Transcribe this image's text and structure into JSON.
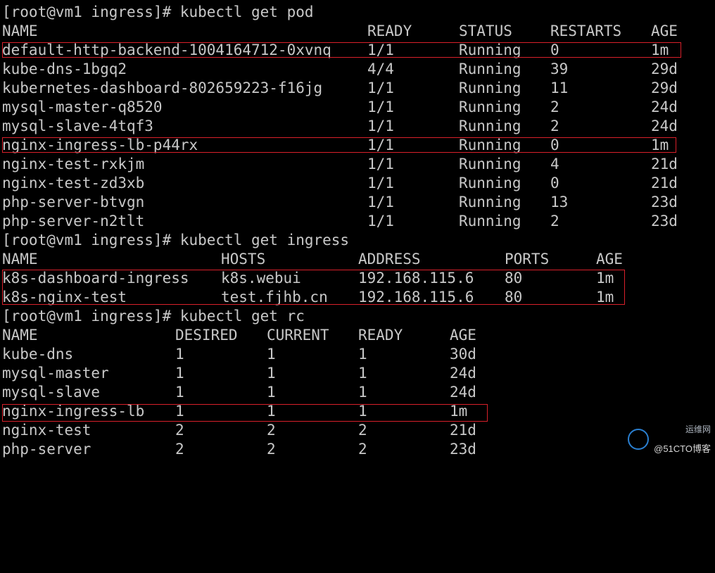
{
  "prompt1": "[root@vm1 ingress]# kubectl get pod",
  "pods": {
    "headers": [
      "NAME",
      "READY",
      "STATUS",
      "RESTARTS",
      "AGE"
    ],
    "rows": [
      [
        "default-http-backend-1004164712-0xvnq",
        "1/1",
        "Running",
        "0",
        "1m"
      ],
      [
        "kube-dns-1bgq2",
        "4/4",
        "Running",
        "39",
        "29d"
      ],
      [
        "kubernetes-dashboard-802659223-f16jg",
        "1/1",
        "Running",
        "11",
        "29d"
      ],
      [
        "mysql-master-q8520",
        "1/1",
        "Running",
        "2",
        "24d"
      ],
      [
        "mysql-slave-4tqf3",
        "1/1",
        "Running",
        "2",
        "24d"
      ],
      [
        "nginx-ingress-lb-p44rx",
        "1/1",
        "Running",
        "0",
        "1m"
      ],
      [
        "nginx-test-rxkjm",
        "1/1",
        "Running",
        "4",
        "21d"
      ],
      [
        "nginx-test-zd3xb",
        "1/1",
        "Running",
        "0",
        "21d"
      ],
      [
        "php-server-btvgn",
        "1/1",
        "Running",
        "13",
        "23d"
      ],
      [
        "php-server-n2tlt",
        "1/1",
        "Running",
        "2",
        "23d"
      ]
    ]
  },
  "prompt2": "[root@vm1 ingress]# kubectl get ingress",
  "ingress": {
    "headers": [
      "NAME",
      "HOSTS",
      "ADDRESS",
      "PORTS",
      "AGE"
    ],
    "rows": [
      [
        "k8s-dashboard-ingress",
        "k8s.webui",
        "192.168.115.6",
        "80",
        "1m"
      ],
      [
        "k8s-nginx-test",
        "test.fjhb.cn",
        "192.168.115.6",
        "80",
        "1m"
      ]
    ]
  },
  "prompt3": "[root@vm1 ingress]# kubectl get rc",
  "rc": {
    "headers": [
      "NAME",
      "DESIRED",
      "CURRENT",
      "READY",
      "AGE"
    ],
    "rows": [
      [
        "kube-dns",
        "1",
        "1",
        "1",
        "30d"
      ],
      [
        "mysql-master",
        "1",
        "1",
        "1",
        "24d"
      ],
      [
        "mysql-slave",
        "1",
        "1",
        "1",
        "24d"
      ],
      [
        "nginx-ingress-lb",
        "1",
        "1",
        "1",
        "1m"
      ],
      [
        "nginx-test",
        "2",
        "2",
        "2",
        "21d"
      ],
      [
        "php-server",
        "2",
        "2",
        "2",
        "23d"
      ]
    ]
  },
  "watermark": {
    "line1": "运维网",
    "line2": "@51CTO博客"
  },
  "colors": {
    "background": "#000000",
    "text": "#c8c8c8",
    "highlight_box": "#d8202a"
  }
}
